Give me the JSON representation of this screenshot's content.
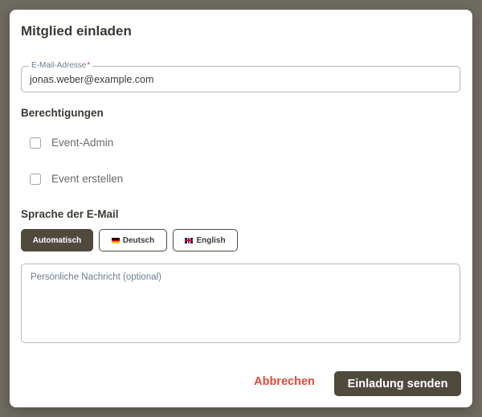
{
  "dialog": {
    "title": "Mitglied einladen",
    "email_field": {
      "label": "E-Mail-Adresse",
      "required_mark": "*",
      "value": "jonas.weber@example.com"
    },
    "permissions": {
      "heading": "Berechtigungen",
      "items": [
        {
          "label": "Event-Admin",
          "checked": false
        },
        {
          "label": "Event erstellen",
          "checked": false
        }
      ]
    },
    "language": {
      "heading": "Sprache der E-Mail",
      "options": [
        {
          "label": "Automatisch",
          "flag": "",
          "selected": true
        },
        {
          "label": "Deutsch",
          "flag": "flag-de",
          "selected": false
        },
        {
          "label": "English",
          "flag": "flag-gb",
          "selected": false
        }
      ]
    },
    "message": {
      "placeholder": "Persönliche Nachricht (optional)"
    },
    "actions": {
      "cancel_label": "Abbrechen",
      "submit_label": "Einladung senden"
    }
  },
  "colors": {
    "primary": "#4f4a3c",
    "danger": "#e2493a",
    "backdrop": "#6f6b61"
  }
}
